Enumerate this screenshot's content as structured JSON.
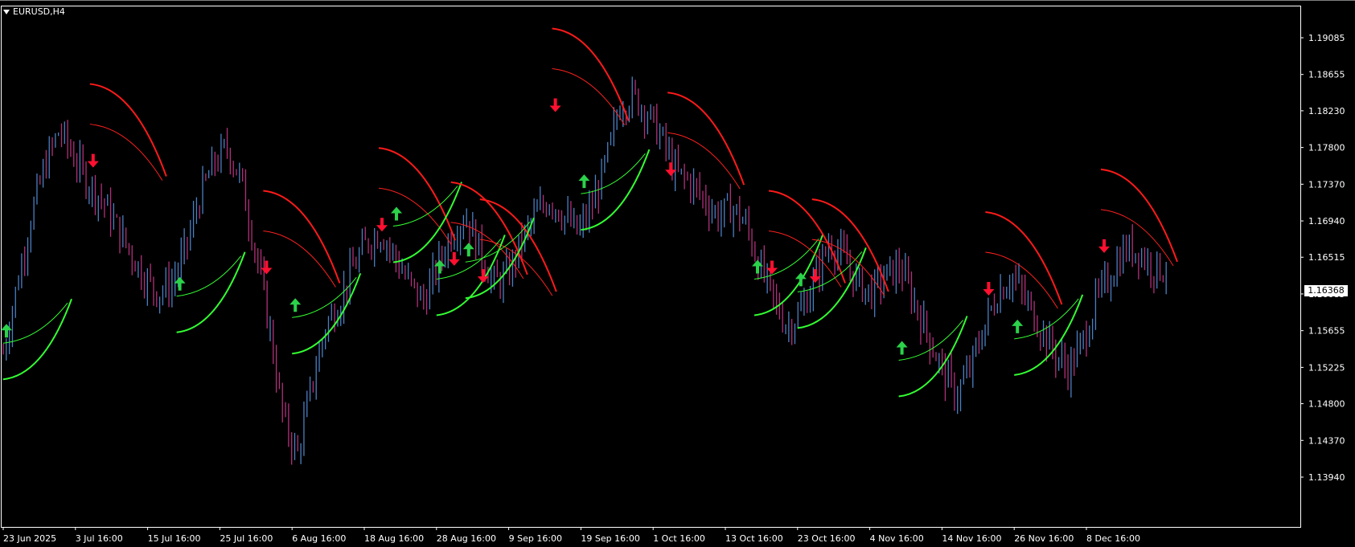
{
  "chart": {
    "symbol": "EURUSD,H4",
    "current_price": "1.16368"
  },
  "colors": {
    "background": "#000000",
    "frame": "#ffffff",
    "bull_bar": "#4a7fc1",
    "bear_bar": "#b0307a",
    "resistance_curve": "#ff1a1a",
    "support_curve": "#33ff33",
    "up_arrow": "#2bd24a",
    "down_arrow": "#ff1030",
    "trail_line_bear": "#ff2020",
    "trail_line_bull": "#33ff33"
  },
  "chart_data": {
    "type": "candlestick",
    "timeframe": "H4",
    "ylim": [
      1.138,
      1.194
    ],
    "y_ticks": [
      "1.19085",
      "1.18655",
      "1.18230",
      "1.17800",
      "1.17370",
      "1.16940",
      "1.16515",
      "1.16085",
      "1.15655",
      "1.15225",
      "1.14800",
      "1.14370",
      "1.13940"
    ],
    "x_ticks": [
      "23 Jun 2025",
      "3 Jul 16:00",
      "15 Jul 16:00",
      "25 Jul 16:00",
      "6 Aug 16:00",
      "18 Aug 16:00",
      "28 Aug 16:00",
      "9 Sep 16:00",
      "19 Sep 16:00",
      "1 Oct 16:00",
      "13 Oct 16:00",
      "23 Oct 16:00",
      "4 Nov 16:00",
      "14 Nov 16:00",
      "26 Nov 16:00",
      "8 Dec 16:00"
    ],
    "close_path": [
      1.154,
      1.162,
      1.17,
      1.176,
      1.18,
      1.177,
      1.174,
      1.172,
      1.169,
      1.166,
      1.163,
      1.161,
      1.162,
      1.166,
      1.172,
      1.176,
      1.178,
      1.174,
      1.166,
      1.157,
      1.146,
      1.142,
      1.15,
      1.157,
      1.16,
      1.164,
      1.167,
      1.168,
      1.165,
      1.162,
      1.16,
      1.164,
      1.168,
      1.17,
      1.166,
      1.162,
      1.163,
      1.167,
      1.17,
      1.172,
      1.17,
      1.168,
      1.171,
      1.176,
      1.183,
      1.184,
      1.182,
      1.179,
      1.175,
      1.174,
      1.172,
      1.17,
      1.171,
      1.169,
      1.164,
      1.16,
      1.157,
      1.159,
      1.163,
      1.167,
      1.165,
      1.162,
      1.161,
      1.163,
      1.164,
      1.16,
      1.156,
      1.152,
      1.149,
      1.152,
      1.157,
      1.161,
      1.163,
      1.16,
      1.157,
      1.154,
      1.152,
      1.155,
      1.16,
      1.163,
      1.166,
      1.166,
      1.164,
      1.1637
    ],
    "signals": [
      {
        "type": "up",
        "x": "23 Jun 2025",
        "price": 1.1565
      },
      {
        "type": "down",
        "x": "3 Jul 16:00",
        "price": 1.1765
      },
      {
        "type": "up",
        "x": "15 Jul 16:00",
        "price": 1.162
      },
      {
        "type": "down",
        "x": "25 Jul 16:00",
        "price": 1.164
      },
      {
        "type": "up",
        "x": "6 Aug 16:00",
        "price": 1.1595
      },
      {
        "type": "down",
        "x": "18 Aug 16:00",
        "price": 1.169
      },
      {
        "type": "up",
        "x": "18 Aug 16:00",
        "price": 1.1702
      },
      {
        "type": "down",
        "x": "28 Aug 16:00",
        "price": 1.163
      },
      {
        "type": "up",
        "x": "28 Aug 16:00",
        "price": 1.164
      },
      {
        "type": "down",
        "x": "28 Aug 16:00",
        "price": 1.165
      },
      {
        "type": "up",
        "x": "28 Aug 16:00",
        "price": 1.166
      },
      {
        "type": "down",
        "x": "9 Sep 16:00",
        "price": 1.183
      },
      {
        "type": "up",
        "x": "19 Sep 16:00",
        "price": 1.174
      },
      {
        "type": "down",
        "x": "1 Oct 16:00",
        "price": 1.1755
      },
      {
        "type": "up",
        "x": "13 Oct 16:00",
        "price": 1.164
      },
      {
        "type": "down",
        "x": "13 Oct 16:00",
        "price": 1.164
      },
      {
        "type": "up",
        "x": "23 Oct 16:00",
        "price": 1.1625
      },
      {
        "type": "down",
        "x": "23 Oct 16:00",
        "price": 1.163
      },
      {
        "type": "up",
        "x": "4 Nov 16:00",
        "price": 1.1545
      },
      {
        "type": "down",
        "x": "14 Nov 16:00",
        "price": 1.1615
      },
      {
        "type": "up",
        "x": "26 Nov 16:00",
        "price": 1.157
      },
      {
        "type": "down",
        "x": "8 Dec 16:00",
        "price": 1.1665
      }
    ]
  }
}
